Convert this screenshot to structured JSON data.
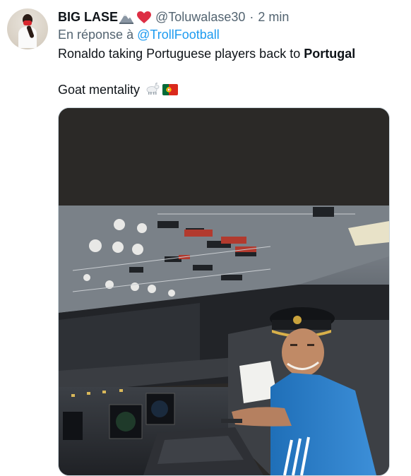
{
  "tweet": {
    "author_name": "BIG LASE",
    "author_handle": "@Toluwalase30",
    "separator": "·",
    "time": "2 min",
    "reply_prefix": "En réponse à",
    "reply_to": "@TrollFootball",
    "line1_text": "Ronaldo taking Portuguese players back to ",
    "line1_bold": "Portugal",
    "line2_text": "Goat mentality",
    "emojis": [
      "snow-mountain-icon",
      "red-heart-icon",
      "goat-icon",
      "portugal-flag-icon"
    ],
    "image_alt": "Cockpit photo"
  },
  "colors": {
    "text": "#0f1419",
    "secondary": "#536471",
    "link": "#1d9bf0",
    "heart": "#e0245e",
    "border": "#cfd9de"
  }
}
